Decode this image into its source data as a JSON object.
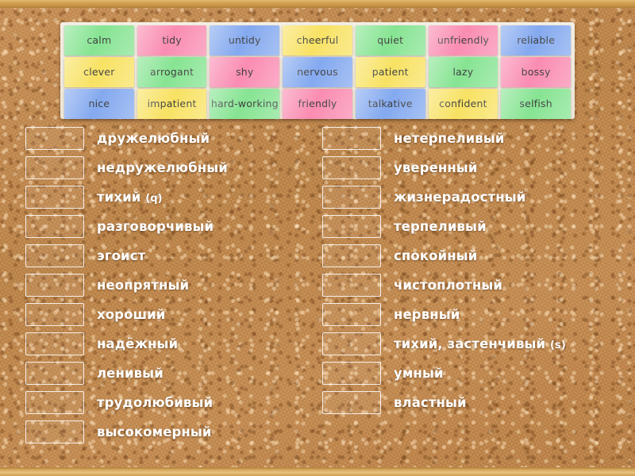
{
  "activity": {
    "type": "match-up-word-tiles",
    "board_background": "cork",
    "frame_color": "#d3a254"
  },
  "tiles": {
    "palette": {
      "green": "#86e492",
      "pink": "#fa8cb2",
      "blue": "#84a9ef",
      "yellow": "#f8e263"
    },
    "rows": [
      [
        {
          "label": "calm",
          "color": "green"
        },
        {
          "label": "tidy",
          "color": "pink"
        },
        {
          "label": "untidy",
          "color": "blue"
        },
        {
          "label": "cheerful",
          "color": "yellow"
        },
        {
          "label": "quiet",
          "color": "green"
        },
        {
          "label": "unfriendly",
          "color": "pink"
        },
        {
          "label": "reliable",
          "color": "blue"
        }
      ],
      [
        {
          "label": "clever",
          "color": "yellow"
        },
        {
          "label": "arrogant",
          "color": "green"
        },
        {
          "label": "shy",
          "color": "pink"
        },
        {
          "label": "nervous",
          "color": "blue"
        },
        {
          "label": "patient",
          "color": "yellow"
        },
        {
          "label": "lazy",
          "color": "green"
        },
        {
          "label": "bossy",
          "color": "pink"
        }
      ],
      [
        {
          "label": "nice",
          "color": "blue"
        },
        {
          "label": "impatient",
          "color": "yellow"
        },
        {
          "label": "hard-working",
          "color": "green"
        },
        {
          "label": "friendly",
          "color": "pink"
        },
        {
          "label": "talkative",
          "color": "blue"
        },
        {
          "label": "confident",
          "color": "yellow"
        },
        {
          "label": "selfish",
          "color": "green"
        }
      ]
    ]
  },
  "answers": {
    "left": [
      {
        "label": "дружелюбный",
        "hint": ""
      },
      {
        "label": "недружелюбный",
        "hint": ""
      },
      {
        "label": "тихий ",
        "hint": "(q)"
      },
      {
        "label": "разговорчивый",
        "hint": ""
      },
      {
        "label": "эгоист",
        "hint": ""
      },
      {
        "label": "неопрятный",
        "hint": ""
      },
      {
        "label": "хороший",
        "hint": ""
      },
      {
        "label": "надёжный",
        "hint": ""
      },
      {
        "label": "ленивый",
        "hint": ""
      },
      {
        "label": "трудолюбивый",
        "hint": ""
      },
      {
        "label": "высокомерный",
        "hint": ""
      }
    ],
    "right": [
      {
        "label": "нетерпеливый",
        "hint": ""
      },
      {
        "label": "уверенный",
        "hint": ""
      },
      {
        "label": "жизнерадостный",
        "hint": ""
      },
      {
        "label": "терпеливый",
        "hint": ""
      },
      {
        "label": "спокойный",
        "hint": ""
      },
      {
        "label": "чистоплотный",
        "hint": ""
      },
      {
        "label": "нервный",
        "hint": ""
      },
      {
        "label": "тихий, застенчивый ",
        "hint": "(s)"
      },
      {
        "label": "умный",
        "hint": ""
      },
      {
        "label": "властный",
        "hint": ""
      }
    ]
  }
}
